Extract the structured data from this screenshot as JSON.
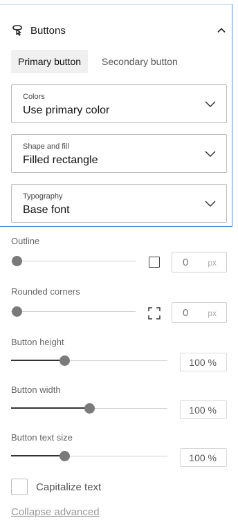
{
  "section": {
    "title": "Buttons",
    "icon": "lock-cursor-icon",
    "expanded_icon": "chevron-up-icon"
  },
  "tabs": [
    {
      "label": "Primary button",
      "active": true
    },
    {
      "label": "Secondary button",
      "active": false
    }
  ],
  "selects": [
    {
      "label": "Colors",
      "value": "Use primary color"
    },
    {
      "label": "Shape and fill",
      "value": "Filled rectangle"
    },
    {
      "label": "Typography",
      "value": "Base font"
    }
  ],
  "outline": {
    "label": "Outline",
    "value": "0",
    "unit": "px",
    "slider_level": 0
  },
  "rounded_corners": {
    "label": "Rounded corners",
    "value": "0",
    "unit": "px",
    "slider_level": 0
  },
  "button_height": {
    "label": "Button height",
    "value": "100 %",
    "slider_level": 0.34
  },
  "button_width": {
    "label": "Button width",
    "value": "100 %",
    "slider_level": 0.5
  },
  "button_text_size": {
    "label": "Button text size",
    "value": "100 %",
    "slider_level": 0.34
  },
  "capitalize": {
    "label": "Capitalize text",
    "checked": false
  },
  "collapse_link": "Collapse advanced",
  "colors": {
    "accent_border": "#4a8fd0",
    "knob": "#7a7a7a"
  }
}
